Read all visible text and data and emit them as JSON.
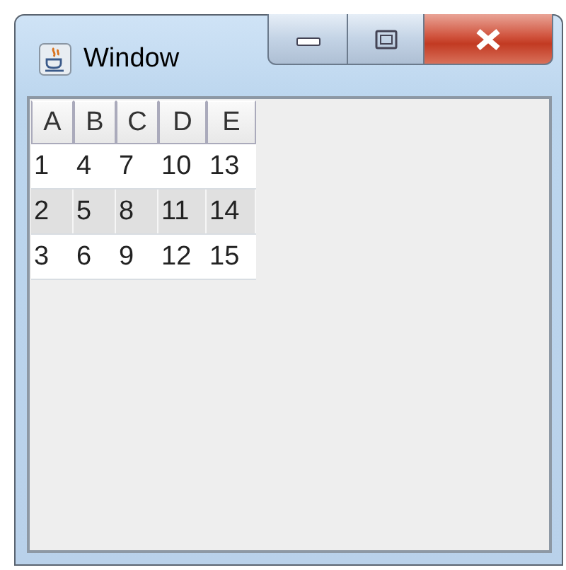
{
  "window": {
    "title": "Window"
  },
  "table": {
    "columns": [
      "A",
      "B",
      "C",
      "D",
      "E"
    ],
    "rows": [
      {
        "cells": [
          "1",
          "4",
          "7",
          "10",
          "13"
        ],
        "selected": false
      },
      {
        "cells": [
          "2",
          "5",
          "8",
          "11",
          "14"
        ],
        "selected": true
      },
      {
        "cells": [
          "3",
          "6",
          "9",
          "12",
          "15"
        ],
        "selected": false
      }
    ]
  }
}
